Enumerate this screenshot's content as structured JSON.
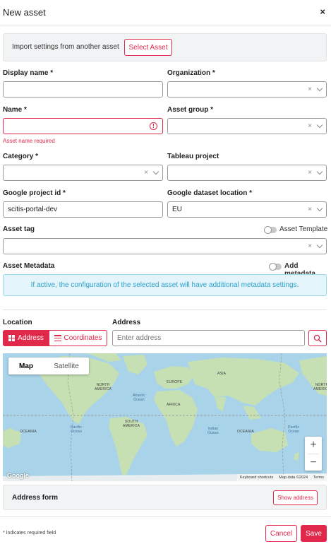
{
  "dialog": {
    "title": "New asset",
    "close_label": "×"
  },
  "import": {
    "text": "Import settings from another asset",
    "button_label": "Select Asset"
  },
  "fields": {
    "display_name": {
      "label": "Display name *",
      "value": ""
    },
    "organization": {
      "label": "Organization *",
      "value": ""
    },
    "name": {
      "label": "Name *",
      "value": "",
      "error": "Asset name required"
    },
    "asset_group": {
      "label": "Asset group *",
      "value": ""
    },
    "category": {
      "label": "Category *",
      "value": ""
    },
    "tableau_project": {
      "label": "Tableau project",
      "value": ""
    },
    "google_project_id": {
      "label": "Google project id *",
      "value": "scitis-portal-dev"
    },
    "google_dataset_location": {
      "label": "Google dataset location *",
      "value": "EU"
    },
    "asset_tag": {
      "label": "Asset tag",
      "value": ""
    }
  },
  "asset_template": {
    "label": "Asset Template",
    "enabled": false
  },
  "metadata": {
    "label": "Asset Metadata",
    "toggle_label": "Add metadata",
    "enabled": false,
    "info": "If active, the configuration of the selected asset will have additional metadata settings."
  },
  "location": {
    "label": "Location",
    "modes": [
      {
        "label": "Address",
        "icon": "grid-icon",
        "active": true
      },
      {
        "label": "Coordinates",
        "icon": "list-icon",
        "active": false
      }
    ]
  },
  "address": {
    "label": "Address",
    "placeholder": "Enter address"
  },
  "map": {
    "tabs": [
      "Map",
      "Satellite"
    ],
    "active_tab": "Map",
    "zoom_in": "+",
    "zoom_out": "−",
    "logo": "Google",
    "attribution": [
      "Keyboard shortcuts",
      "Map data ©2024",
      "Terms"
    ],
    "labels": {
      "north_america": "NORTH\nAMERICA",
      "south_america": "SOUTH\nAMERICA",
      "europe": "EUROPE",
      "africa": "AFRICA",
      "asia": "ASIA",
      "oceania_left": "OCEANIA",
      "oceania_right": "OCEANIA",
      "north_america_right": "NORTH\nAMERICA",
      "atlantic": "Atlantic\nOcean",
      "pacific_left": "Pacific\nOcean",
      "indian": "Indian\nOcean",
      "pacific_right": "Pacific\nOcean"
    },
    "colors": {
      "water": "#a9d3e8",
      "land": "#c6e0b4"
    }
  },
  "address_form": {
    "title": "Address form",
    "button_label": "Show address"
  },
  "footer": {
    "note": "* Indicates required field",
    "cancel_label": "Cancel",
    "save_label": "Save"
  },
  "colors": {
    "accent": "#e0284a",
    "info_text": "#2ba3cf",
    "info_bg": "#e3f4fa"
  }
}
